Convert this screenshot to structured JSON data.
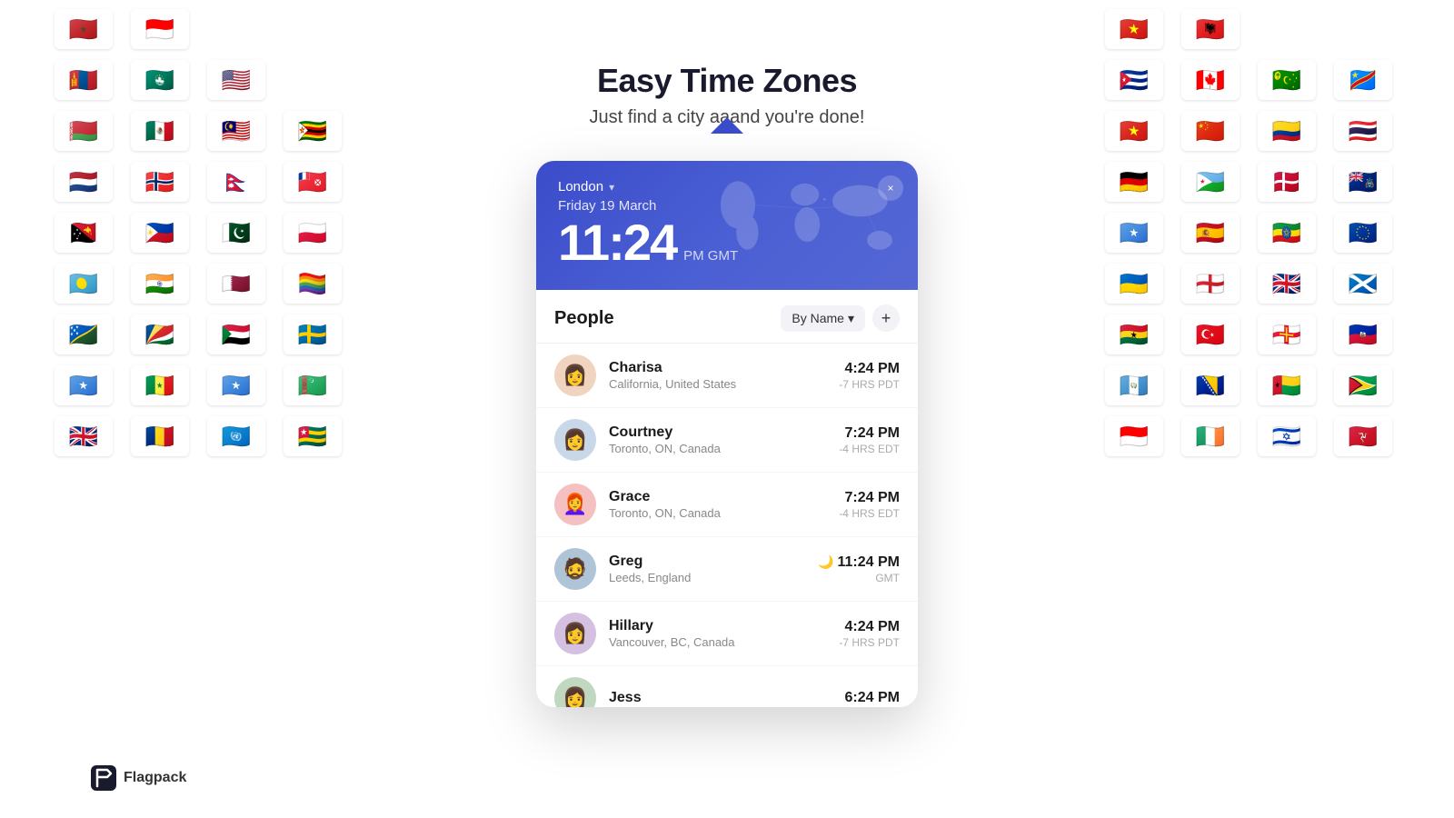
{
  "app": {
    "title": "Easy Time Zones",
    "subtitle": "Just find a city aaand you're done!"
  },
  "header": {
    "location": "London",
    "date": "Friday 19 March",
    "time": "11:24",
    "ampm_tz": "PM GMT",
    "close_label": "×"
  },
  "people": {
    "section_title": "People",
    "sort_label": "By Name",
    "add_label": "+",
    "list": [
      {
        "name": "Charisa",
        "location": "California, United States",
        "time": "4:24 PM",
        "offset": "-7 HRS PDT",
        "avatar_emoji": "👩",
        "avatar_bg": "#f0d4c0",
        "night": false
      },
      {
        "name": "Courtney",
        "location": "Toronto, ON, Canada",
        "time": "7:24 PM",
        "offset": "-4 HRS EDT",
        "avatar_emoji": "👩",
        "avatar_bg": "#c8d8e8",
        "night": false
      },
      {
        "name": "Grace",
        "location": "Toronto, ON, Canada",
        "time": "7:24 PM",
        "offset": "-4 HRS EDT",
        "avatar_emoji": "👩‍🦰",
        "avatar_bg": "#f5c0c0",
        "night": false
      },
      {
        "name": "Greg",
        "location": "Leeds, England",
        "time": "11:24 PM",
        "offset": "GMT",
        "avatar_emoji": "🧔",
        "avatar_bg": "#b0c4d8",
        "night": true
      },
      {
        "name": "Hillary",
        "location": "Vancouver, BC, Canada",
        "time": "4:24 PM",
        "offset": "-7 HRS PDT",
        "avatar_emoji": "👩",
        "avatar_bg": "#d4c0e0",
        "night": false
      },
      {
        "name": "Jess",
        "location": "...",
        "time": "6:24 PM",
        "offset": "",
        "avatar_emoji": "👩",
        "avatar_bg": "#c0d8c0",
        "night": false
      }
    ]
  },
  "left_flags": [
    "🇲🇦",
    "🇮🇩",
    "",
    "",
    "🇲🇳",
    "🇲🇴",
    "🇺🇲",
    "",
    "🇧🇾",
    "🇲🇽",
    "🇲🇾",
    "🇿🇼",
    "🇳🇱",
    "🇳🇴",
    "🇳🇵",
    "🇼🇫",
    "🇵🇬",
    "🇵🇭",
    "🇵🇰",
    "🇵🇱",
    "🇵🇼",
    "🇮🇳",
    "🇶🇦",
    "🏳️‍🌈",
    "🇸🇧",
    "🇸🇨",
    "🇸🇩",
    "🇸🇪",
    "🇸🇴",
    "🇸🇳",
    "🇸🇴",
    "🇹🇲",
    "🇬🇧",
    "🇷🇴",
    "🇺🇳",
    "🇹🇬"
  ],
  "right_flags": [
    "🇻🇳",
    "🇦🇱",
    "",
    "",
    "🇨🇺",
    "🇨🇦",
    "🇨🇨",
    "🇨🇩",
    "🇻🇳",
    "🇨🇳",
    "🇨🇴",
    "🇹🇭",
    "🇩🇪",
    "🇩🇯",
    "🇩🇰",
    "🇦🇨",
    "🇸🇴",
    "🇪🇸",
    "🇪🇹",
    "🇪🇺",
    "🇺🇦",
    "🇬🇧",
    "🏴󠁧󠁢󠁥󠁮󠁧󠁿",
    "🏴󠁧󠁢󠁳󠁣󠁴󠁿",
    "🇬🇭",
    "🇹🇷",
    "🇬🇬",
    "🇭🇹",
    "🇬🇹",
    "🇧🇦",
    "🇬🇼",
    "🇬🇾",
    "🇮🇩",
    "🇮🇪",
    "🇮🇱",
    "🇮🇲"
  ],
  "flagpack": {
    "brand_name": "Flagpack"
  }
}
